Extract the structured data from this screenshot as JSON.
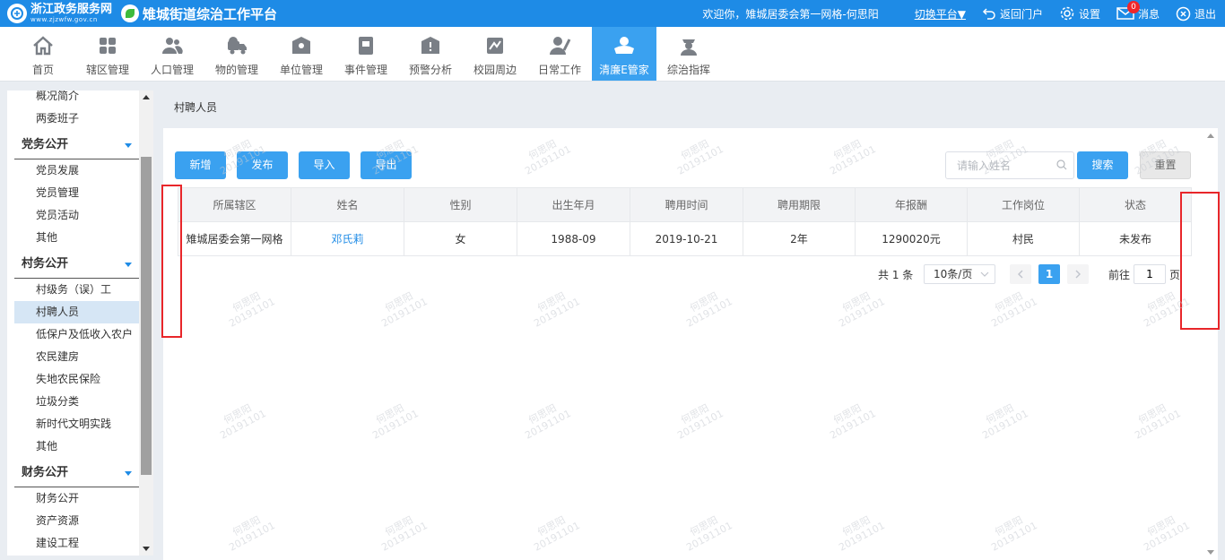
{
  "header": {
    "brand_name": "浙江政务服务网",
    "brand_url": "www.zjzwfw.gov.cn",
    "platform_title": "雉城街道综治工作平台",
    "welcome": "欢迎你，雉城居委会第一网格-何思阳",
    "switch_label": "切换平台▼",
    "back_label": "返回门户",
    "settings_label": "设置",
    "messages_label": "消息",
    "messages_count": "0",
    "logout_label": "退出"
  },
  "nav": [
    {
      "label": "首页",
      "icon": "home-icon"
    },
    {
      "label": "辖区管理",
      "icon": "grid-icon"
    },
    {
      "label": "人口管理",
      "icon": "people-icon"
    },
    {
      "label": "物的管理",
      "icon": "truck-icon"
    },
    {
      "label": "单位管理",
      "icon": "building-icon"
    },
    {
      "label": "事件管理",
      "icon": "book-icon"
    },
    {
      "label": "预警分析",
      "icon": "alert-icon"
    },
    {
      "label": "校园周边",
      "icon": "school-icon"
    },
    {
      "label": "日常工作",
      "icon": "pen-user-icon"
    },
    {
      "label": "清廉E管家",
      "icon": "hands-icon",
      "active": true
    },
    {
      "label": "综治指挥",
      "icon": "officer-icon"
    }
  ],
  "sidebar": {
    "items_top": [
      "概况简介",
      "两委班子"
    ],
    "groups": [
      {
        "title": "党务公开",
        "items": [
          "党员发展",
          "党员管理",
          "党员活动",
          "其他"
        ]
      },
      {
        "title": "村务公开",
        "items": [
          "村级务（误）工",
          "村聘人员",
          "低保户及低收入农户",
          "农民建房",
          "失地农民保险",
          "垃圾分类",
          "新时代文明实践",
          "其他"
        ]
      },
      {
        "title": "财务公开",
        "items": [
          "财务公开",
          "资产资源",
          "建设工程"
        ]
      }
    ],
    "active_item": "村聘人员"
  },
  "breadcrumb": "村聘人员",
  "toolbar": {
    "add_label": "新增",
    "publish_label": "发布",
    "import_label": "导入",
    "export_label": "导出",
    "search_placeholder": "请输入姓名",
    "search_label": "搜索",
    "reset_label": "重置"
  },
  "table": {
    "columns": [
      "所属辖区",
      "姓名",
      "性别",
      "出生年月",
      "聘用时间",
      "聘用期限",
      "年报酬",
      "工作岗位",
      "状态"
    ],
    "rows": [
      [
        "雉城居委会第一网格",
        "邓氏莉",
        "女",
        "1988-09",
        "2019-10-21",
        "2年",
        "1290020元",
        "村民",
        "未发布"
      ]
    ]
  },
  "pagination": {
    "total_text": "共 1 条",
    "page_size": "10条/页",
    "current_page": "1",
    "goto_label": "前往",
    "goto_value": "1",
    "page_suffix": "页"
  },
  "watermark": {
    "name": "何思阳",
    "code": "20191101"
  },
  "colors": {
    "primary": "#1e8be6",
    "button": "#3aa1f0",
    "highlight_box": "#e8262a"
  }
}
